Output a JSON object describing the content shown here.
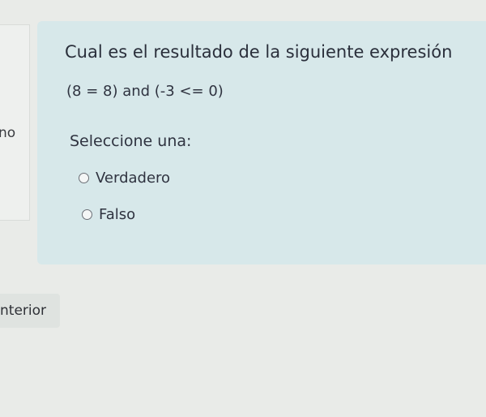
{
  "left_panel": {
    "fragment_text": "no"
  },
  "question": {
    "text": "Cual es el resultado de la siguiente expresión",
    "expression": "(8 = 8) and (-3 <= 0)",
    "prompt": "Seleccione una:",
    "options": [
      {
        "label": "Verdadero",
        "selected": false
      },
      {
        "label": "Falso",
        "selected": false
      }
    ]
  },
  "navigation": {
    "previous_label": "nterior"
  }
}
